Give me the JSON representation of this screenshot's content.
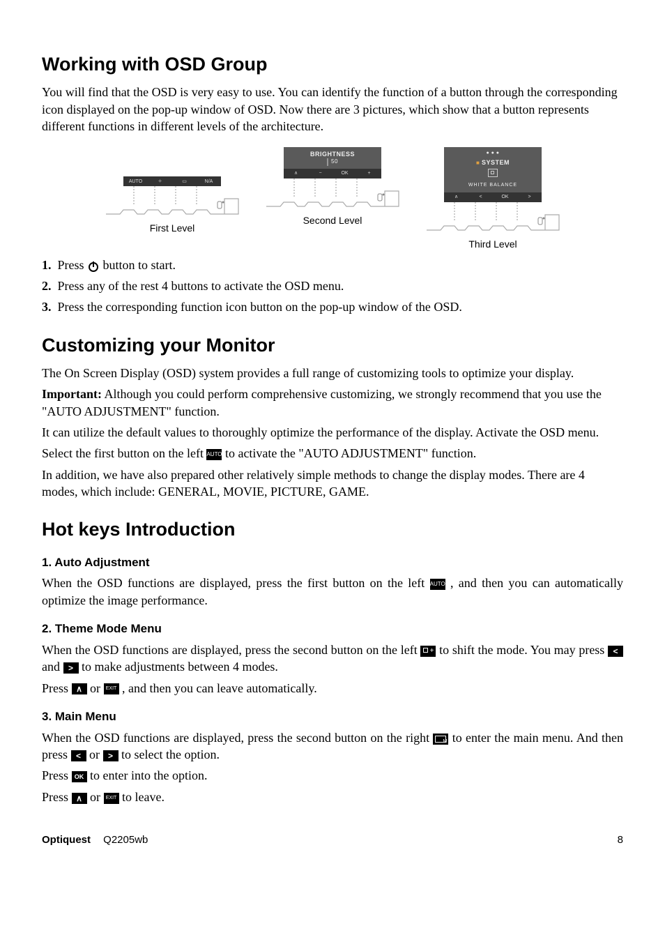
{
  "headings": {
    "working": "Working with OSD Group",
    "customizing": "Customizing your Monitor",
    "hotkeys": "Hot keys Introduction"
  },
  "working": {
    "intro": "You will find that the OSD is very easy to use. You can identify the function of a button through the corresponding icon displayed on the pop-up window of OSD. Now there are 3 pictures, which show that a button represents different functions in different levels of the architecture.",
    "diagram": {
      "first": {
        "label": "First Level",
        "buttons": [
          "AUTO",
          "✧",
          "▭",
          "N/A"
        ]
      },
      "second": {
        "label": "Second Level",
        "popupTitle": "BRIGHTNESS",
        "popupValue": "50",
        "buttons": [
          "∧",
          "−",
          "OK",
          "+"
        ]
      },
      "third": {
        "label": "Third Level",
        "popupTitle": "SYSTEM",
        "popupSubtitle": "WHITE  BALANCE",
        "buttons": [
          "∧",
          "<",
          "OK",
          ">"
        ]
      }
    },
    "steps": {
      "s1num": "1.",
      "s1a": "Press ",
      "s1b": " button to start.",
      "s2num": "2.",
      "s2": "Press any of the rest 4 buttons to activate the OSD menu.",
      "s3num": "3.",
      "s3": "Press the corresponding function icon button on the pop-up window of the OSD."
    }
  },
  "customizing": {
    "p1": "The On Screen Display (OSD) system provides a full range of customizing tools to optimize your display.",
    "importantLabel": "Important:",
    "important": " Although you could perform comprehensive customizing, we strongly recommend that you use the \"AUTO ADJUSTMENT\" function.",
    "p3": "It can utilize the default values to thoroughly optimize the performance of the display. Activate the OSD menu.",
    "p4a": "Select the first button on the left ",
    "p4b": " to activate the \"AUTO ADJUSTMENT\" function.",
    "p5": "In addition, we have also prepared other relatively simple methods to change the display modes. There are 4 modes, which include: GENERAL, MOVIE, PICTURE, GAME."
  },
  "hotkeys": {
    "h1": "1. Auto Adjustment",
    "auto_a": "When the OSD functions are displayed, press the first button on the left ",
    "auto_b": " , and then you can automatically optimize the image performance.",
    "h2": "2. Theme Mode Menu",
    "theme_a": "When the OSD functions are displayed, press the second button on the left ",
    "theme_b": " to shift the mode. You may press ",
    "theme_c": " and ",
    "theme_d": "  to make adjustments between 4 modes.",
    "theme_e1": "Press ",
    "theme_e2": " or ",
    "theme_e3": " , and then you can leave automatically.",
    "h3": "3. Main Menu",
    "main_a": "When the OSD functions are displayed, press the second button on the right ",
    "main_b": " to enter the main menu. And then press ",
    "main_c": "  or ",
    "main_d": "  to select the option.",
    "main_e1": "Press ",
    "main_e2": " to enter into the option.",
    "main_f1": "Press ",
    "main_f2": " or ",
    "main_f3": " to leave."
  },
  "icons": {
    "auto": "AUTO",
    "ok": "OK",
    "exit": "EXIT",
    "left": "<",
    "right": ">",
    "up": "∧"
  },
  "footer": {
    "brand": "Optiquest",
    "model": "Q2205wb",
    "page": "8"
  }
}
